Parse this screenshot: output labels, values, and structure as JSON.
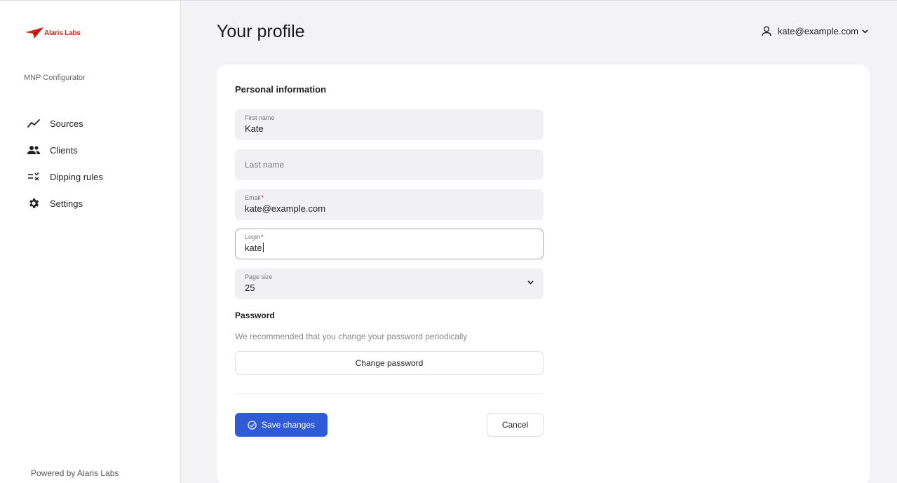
{
  "brand": {
    "logo_text": "Alaris Labs",
    "accent": "#d8241c"
  },
  "sidebar": {
    "app_name": "MNP Configurator",
    "items": [
      {
        "label": "Sources",
        "icon": "trend-line-icon"
      },
      {
        "label": "Clients",
        "icon": "people-icon"
      },
      {
        "label": "Dipping rules",
        "icon": "rules-check-icon"
      },
      {
        "label": "Settings",
        "icon": "gear-icon"
      }
    ],
    "footer": "Powered by Alaris Labs"
  },
  "header": {
    "title": "Your profile",
    "user_email": "kate@example.com"
  },
  "form": {
    "section_title": "Personal information",
    "first_name": {
      "label": "First name",
      "value": "Kate"
    },
    "last_name": {
      "placeholder": "Last name"
    },
    "email": {
      "label": "Email",
      "required_mark": "*",
      "value": "kate@example.com"
    },
    "login": {
      "label": "Login",
      "required_mark": "*",
      "value": "kate"
    },
    "page_size": {
      "label": "Page size",
      "value": "25"
    },
    "password": {
      "title": "Password",
      "description": "We recommended that you change your password periodically",
      "button": "Change password"
    },
    "save_label": "Save changes",
    "cancel_label": "Cancel"
  },
  "colors": {
    "primary": "#2f5bd6",
    "required": "#d8241c"
  }
}
